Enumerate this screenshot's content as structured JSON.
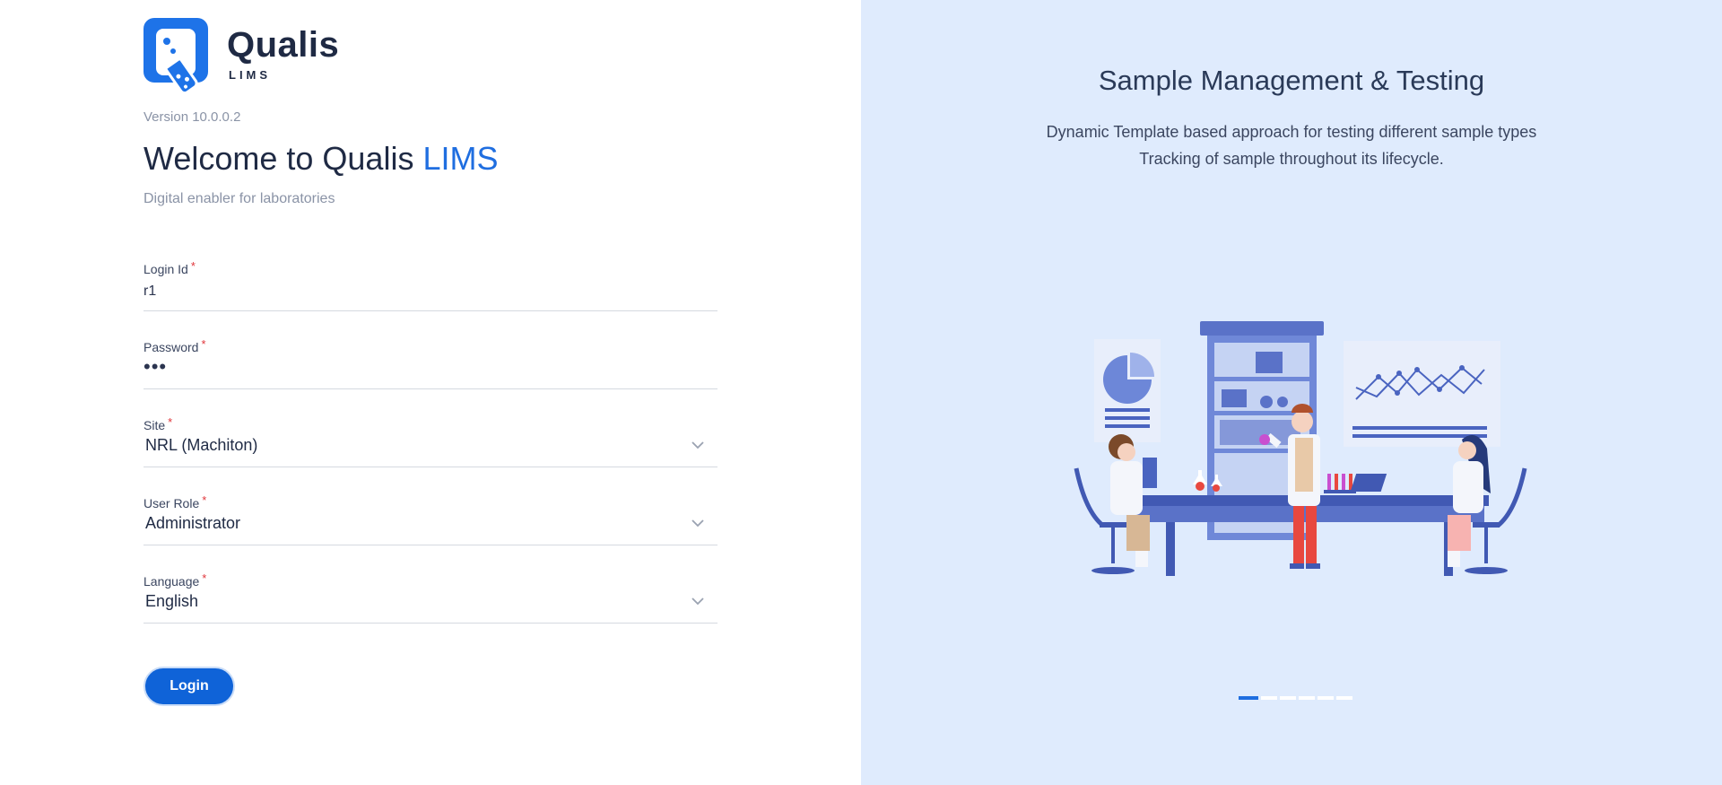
{
  "brand": {
    "name": "Qualis",
    "sub": "LIMS",
    "version": "Version 10.0.0.2",
    "welcome_prefix": "Welcome to Qualis ",
    "welcome_accent": "LIMS",
    "tagline": "Digital enabler for laboratories",
    "logo_icon": "flask-icon"
  },
  "form": {
    "login_id": {
      "label": "Login Id",
      "value": "r1"
    },
    "password": {
      "label": "Password",
      "value": "•••"
    },
    "site": {
      "label": "Site",
      "value": "NRL (Machiton)"
    },
    "user_role": {
      "label": "User Role",
      "value": "Administrator"
    },
    "language": {
      "label": "Language",
      "value": "English"
    },
    "required_mark": "*",
    "login_label": "Login"
  },
  "carousel": {
    "title": "Sample Management & Testing",
    "line1": "Dynamic Template based approach for testing different sample types",
    "line2": "Tracking of sample throughout its lifecycle.",
    "slide_count": 6,
    "active_slide": 1
  },
  "colors": {
    "accent": "#1f6ee0",
    "panel": "#dfebfd",
    "required": "#e0363b",
    "button": "#0f63d8"
  }
}
